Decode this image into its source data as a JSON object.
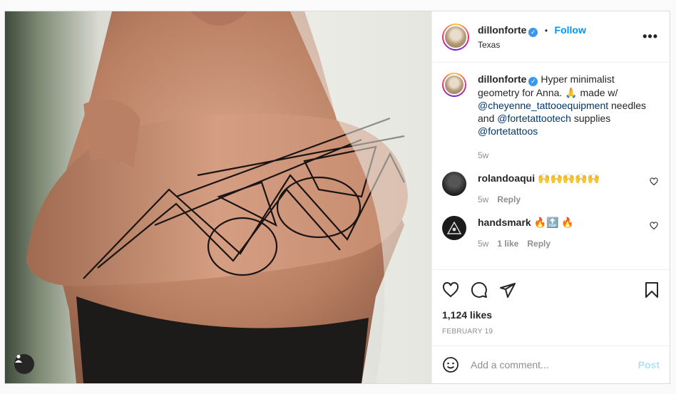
{
  "post": {
    "username": "dillonforte",
    "follow_label": "Follow",
    "separator": "•",
    "location": "Texas",
    "more_label": "•••",
    "caption": {
      "text1": "Hyper minimalist geometry for Anna. 🙏 made w/",
      "mention1": "@cheyenne_tattooequipment",
      "text2": "needles and",
      "mention2": "@fortetattootech",
      "text3": "supplies",
      "mention3": "@fortetattoos",
      "time": "5w"
    },
    "comments": [
      {
        "username": "rolandoaqui",
        "text": "🙌🙌🙌🙌🙌",
        "time": "5w",
        "likes": "",
        "reply": "Reply"
      },
      {
        "username": "handsmark",
        "text": "🔥🔝 🔥",
        "time": "5w",
        "likes": "1 like",
        "reply": "Reply"
      }
    ],
    "likes": "1,124 likes",
    "date": "February 19",
    "add_comment_placeholder": "Add a comment...",
    "post_label": "Post",
    "emoji_icon": "smiley-icon"
  }
}
